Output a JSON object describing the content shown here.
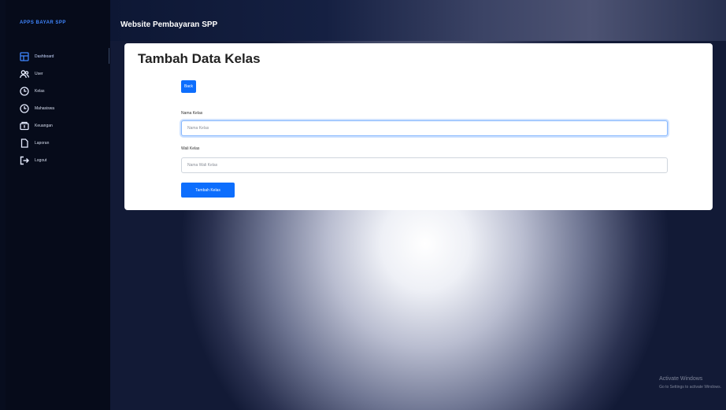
{
  "sidebar": {
    "brand": "APPS BAYAR SPP",
    "items": [
      {
        "label": "Dashboard",
        "icon": "table-icon",
        "active": true
      },
      {
        "label": "User",
        "icon": "users-icon"
      },
      {
        "label": "Kelas",
        "icon": "clock-icon"
      },
      {
        "label": "Mahasiswa",
        "icon": "clock-icon"
      },
      {
        "label": "Keuangan",
        "icon": "wallet-icon"
      },
      {
        "label": "Laporan",
        "icon": "file-icon"
      },
      {
        "label": "Logout",
        "icon": "logout-icon"
      }
    ]
  },
  "header": {
    "title": "Website Pembayaran SPP"
  },
  "main": {
    "title": "Tambah Data Kelas",
    "back_button": "Back",
    "fields": [
      {
        "label": "Nama Kelas",
        "placeholder": "Nama Kelas"
      },
      {
        "label": "Wali Kelas",
        "placeholder": "Nama Wali Kelas"
      }
    ],
    "submit_button": "Tambah Kelas"
  },
  "watermark": {
    "line1": "Activate Windows",
    "line2": "Go to Settings to activate Windows."
  },
  "colors": {
    "accent": "#0d6efd",
    "sidebar_bg": "#060b1a"
  }
}
